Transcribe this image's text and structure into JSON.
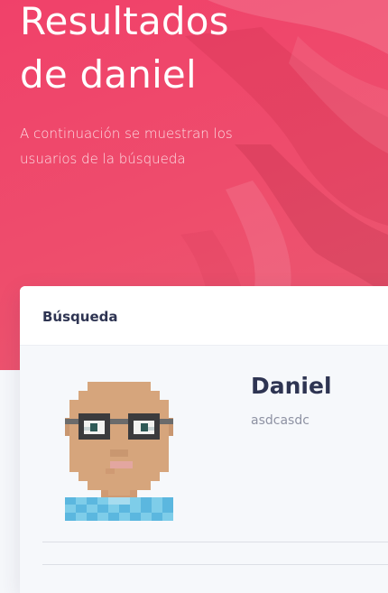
{
  "hero": {
    "title_line1": "Resultados",
    "title_line2": "de daniel",
    "subtitle_line1": "A continuación se muestran los",
    "subtitle_line2": "usuarios de la búsqueda",
    "accent_color": "#f0416a"
  },
  "search_card": {
    "title": "Búsqueda",
    "results": [
      {
        "name": "Daniel",
        "username": "asdcasdc",
        "avatar": "pixel-avatar-icon"
      }
    ]
  },
  "colors": {
    "text_primary": "#2e3452",
    "text_secondary": "#8e92a3",
    "skin": "#d6a57c",
    "shirt": "#6cc4e6"
  }
}
